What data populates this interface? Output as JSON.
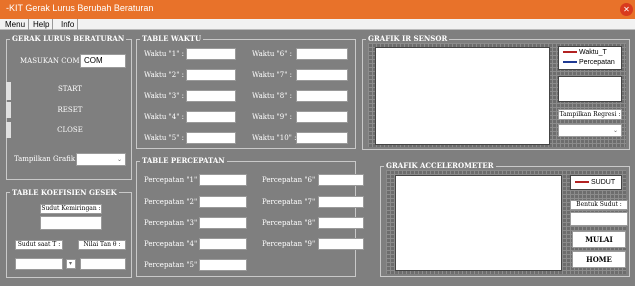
{
  "window": {
    "title": "-KIT Gerak Lurus Berubah Beraturan",
    "close_glyph": "✕"
  },
  "menu": [
    "Menu",
    "Help",
    "Info"
  ],
  "glb": {
    "title": "GERAK LURUS BERATURAN",
    "com_label": "MASUKAN COM",
    "com_value": "COM",
    "start": "START",
    "reset": "RESET",
    "close": "CLOSE",
    "grafik_label": "Tampilkan Grafik :"
  },
  "koef": {
    "title": "TABLE KOEFISIEN GESEK",
    "sudut_label": "Sudut Kemiringan :",
    "sudut_saat": "Sudut saat T :",
    "nilai_tan": "Nilai Tan θ :"
  },
  "waktu": {
    "title": "TABLE WAKTU",
    "labels": [
      "Waktu \"1\" :",
      "Waktu \"2\" :",
      "Waktu \"3\" :",
      "Waktu \"4\" :",
      "Waktu \"5\" :",
      "Waktu \"6\" :",
      "Waktu \"7\" :",
      "Waktu \"8\" :",
      "Waktu \"9\" :",
      "Waktu \"10\" :"
    ]
  },
  "percepatan": {
    "title": "TABLE PERCEPATAN",
    "labels": [
      "Percepatan \"1\" :",
      "Percepatan \"2\" :",
      "Percepatan \"3\" :",
      "Percepatan \"4\" :",
      "Percepatan \"5\" :",
      "Percepatan \"6\" :",
      "Percepatan \"7\" :",
      "Percepatan \"8\" :",
      "Percepatan \"9\" :"
    ]
  },
  "ir": {
    "title": "GRAFIK IR SENSOR",
    "legend": [
      {
        "name": "Waktu_T",
        "color": "#b22222"
      },
      {
        "name": "Percepatan",
        "color": "#1f3a93"
      }
    ],
    "regresi_label": "Tampilkan Regresi :"
  },
  "acc": {
    "title": "GRAFIK ACCELEROMETER",
    "legend": [
      {
        "name": "SUDUT",
        "color": "#b22222"
      }
    ],
    "bentuk_label": "Bentuk Sudut :",
    "mulai": "MULAI",
    "home": "HOME"
  },
  "icons": {
    "dropdown": "chevron-down-icon",
    "legend_line": "legend-line-icon"
  }
}
